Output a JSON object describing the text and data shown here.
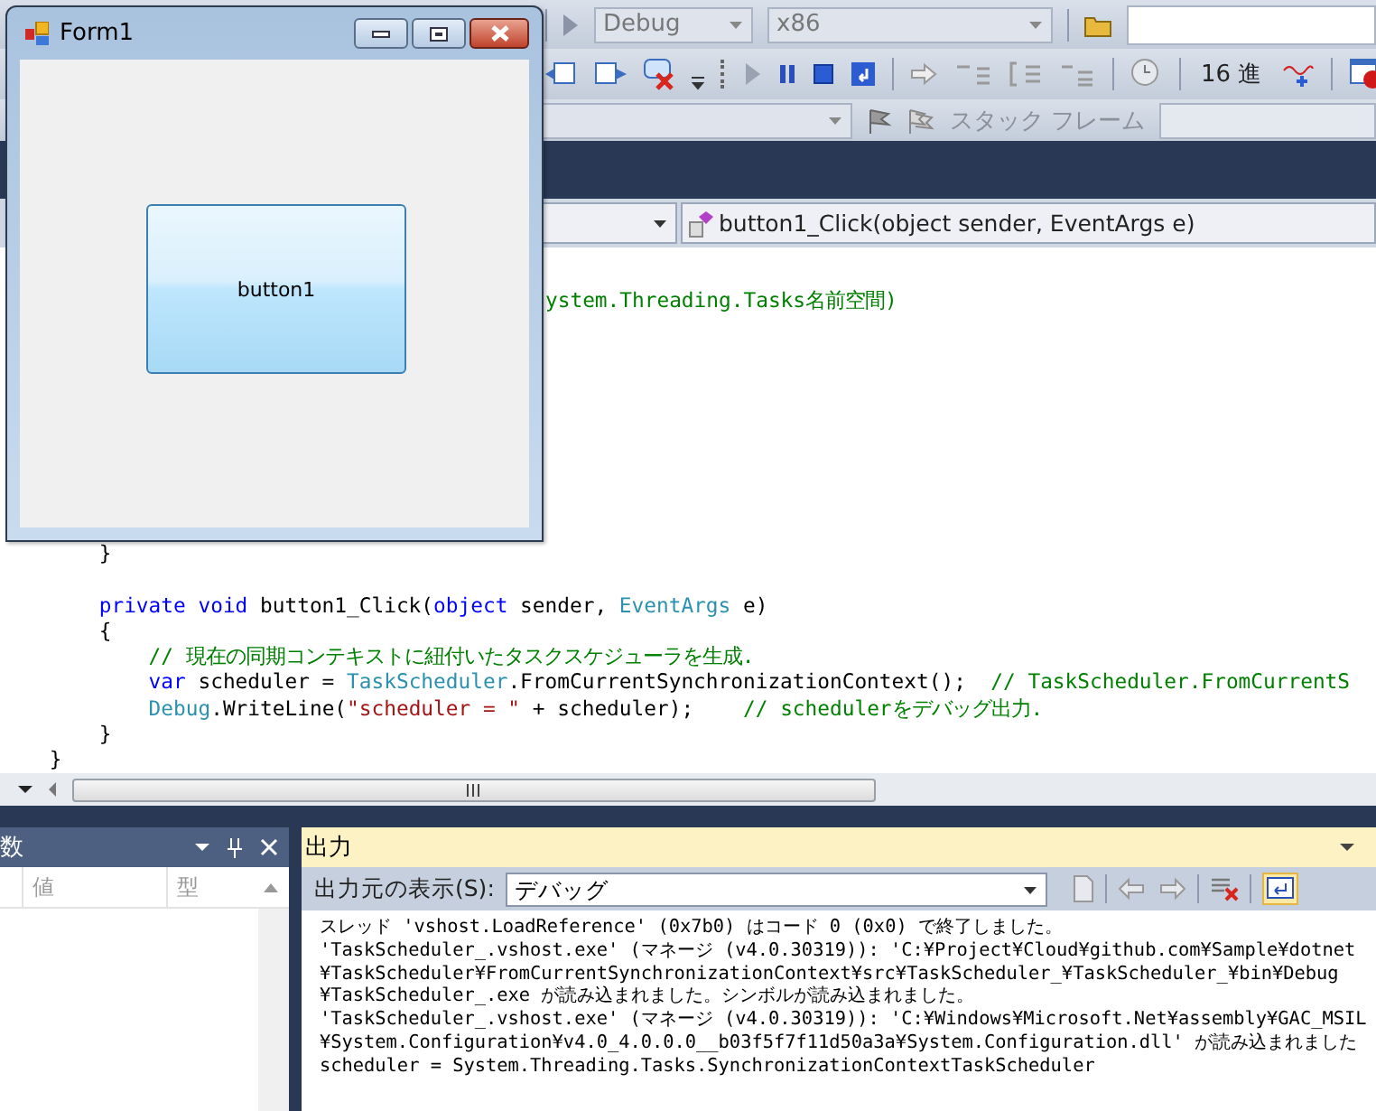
{
  "toolbar_1": {
    "configuration": "Debug",
    "platform": "x86"
  },
  "toolbar_2": {
    "hex_button": "16 進"
  },
  "toolbar_3": {
    "stack_frame_label": "スタック フレーム"
  },
  "navigation_bar": {
    "member": "button1_Click(object sender, EventArgs e)"
  },
  "code_lines": [
    {
      "tokens": [
        {
          "kind": "comment",
          "text": "ystem.Threading.Tasks名前空間)"
        }
      ]
    },
    {
      "tokens": [
        {
          "kind": "plain",
          "text": "        }"
        }
      ]
    },
    {
      "tokens": [
        {
          "kind": "keyword",
          "text": "        private void "
        },
        {
          "kind": "plain",
          "text": "button1_Click("
        },
        {
          "kind": "keyword",
          "text": "object"
        },
        {
          "kind": "plain",
          "text": " sender, "
        },
        {
          "kind": "type",
          "text": "EventArgs"
        },
        {
          "kind": "plain",
          "text": " e)"
        }
      ]
    },
    {
      "tokens": [
        {
          "kind": "plain",
          "text": "        {"
        }
      ]
    },
    {
      "tokens": [
        {
          "kind": "comment",
          "text": "            // 現在の同期コンテキストに紐付いたタスクスケジューラを生成."
        }
      ]
    },
    {
      "tokens": [
        {
          "kind": "keyword",
          "text": "            var"
        },
        {
          "kind": "plain",
          "text": " scheduler = "
        },
        {
          "kind": "type",
          "text": "TaskScheduler"
        },
        {
          "kind": "plain",
          "text": ".FromCurrentSynchronizationContext();  "
        },
        {
          "kind": "comment",
          "text": "// TaskScheduler.FromCurrentS"
        }
      ]
    },
    {
      "tokens": [
        {
          "kind": "type",
          "text": "            Debug"
        },
        {
          "kind": "plain",
          "text": ".WriteLine("
        },
        {
          "kind": "string",
          "text": "\"scheduler = \""
        },
        {
          "kind": "plain",
          "text": " + scheduler);    "
        },
        {
          "kind": "comment",
          "text": "// schedulerをデバッグ出力."
        }
      ]
    },
    {
      "tokens": [
        {
          "kind": "plain",
          "text": "        }"
        }
      ]
    },
    {
      "tokens": [
        {
          "kind": "plain",
          "text": "    }"
        }
      ]
    }
  ],
  "locals_panel": {
    "title": "数",
    "columns": [
      "値",
      "型"
    ]
  },
  "output_panel": {
    "title": "出力",
    "source_label": "出力元の表示(S):",
    "source": "デバッグ",
    "lines": [
      "スレッド 'vshost.LoadReference' (0x7b0) はコード 0 (0x0) で終了しました。",
      "'TaskScheduler_.vshost.exe' (マネージ (v4.0.30319)): 'C:¥Project¥Cloud¥github.com¥Sample¥dotnet",
      "¥TaskScheduler¥FromCurrentSynchronizationContext¥src¥TaskScheduler_¥TaskScheduler_¥bin¥Debug",
      "¥TaskScheduler_.exe が読み込まれました。シンボルが読み込まれました。",
      "'TaskScheduler_.vshost.exe' (マネージ (v4.0.30319)): 'C:¥Windows¥Microsoft.Net¥assembly¥GAC_MSIL",
      "¥System.Configuration¥v4.0_4.0.0.0__b03f5f7f11d50a3a¥System.Configuration.dll' が読み込まれました",
      "scheduler = System.Threading.Tasks.SynchronizationContextTaskScheduler"
    ]
  },
  "form_window": {
    "title": "Form1",
    "button": "button1"
  }
}
